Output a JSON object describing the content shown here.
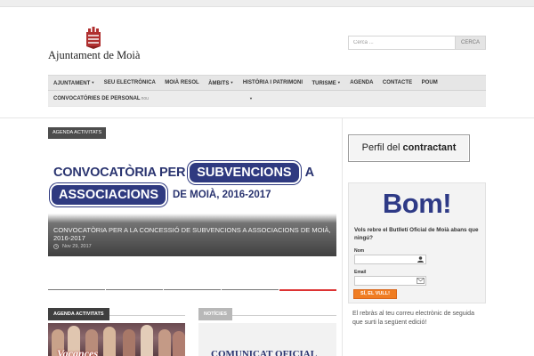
{
  "logo": {
    "text": "Ajuntament de Moià"
  },
  "search": {
    "placeholder": "Cerca ...",
    "button_label": "CERCA"
  },
  "nav": {
    "row1": [
      {
        "label": "Ajuntament",
        "dropdown": true
      },
      {
        "label": "Seu electrònica",
        "dropdown": false
      },
      {
        "label": "Moià resol",
        "dropdown": false
      },
      {
        "label": "Àmbits",
        "dropdown": true
      },
      {
        "label": "Història i patrimoni",
        "dropdown": false
      },
      {
        "label": "Turisme",
        "dropdown": true
      },
      {
        "label": "Agenda",
        "dropdown": false
      },
      {
        "label": "Contacte",
        "dropdown": false
      },
      {
        "label": "POUM",
        "dropdown": false
      }
    ],
    "row2_select": {
      "label": "Convocatòries de personal",
      "suffix": "nou"
    }
  },
  "slider": {
    "tag": "Agenda activitats",
    "image_text": {
      "part1": "CONVOCATÒRIA PER",
      "pill1": "SUBVENCIONS",
      "part2": "A",
      "pill2": "ASSOCIACIONS",
      "part3": "DE MOIÀ, 2016-2017"
    },
    "caption": "Convocatòria per a la concessió de subvencions a associacions de Moià, 2016-2017",
    "date": "Nov 29, 2017",
    "tab_count": 5,
    "active_tab": 5
  },
  "sections": {
    "left": {
      "label": "Agenda activitats",
      "thumb_text": "Vacances"
    },
    "right": {
      "label": "Notícies",
      "thumb_text": "COMUNICAT OFICIAL"
    }
  },
  "sidebar": {
    "perfil": {
      "light": "Perfil del",
      "bold": "contractant"
    },
    "newsletter": {
      "headline": "Bom!",
      "text": "Vols rebre el Butlletí Oficial de Moià abans que ningú?",
      "name_label": "Nom",
      "email_label": "Email",
      "button": "Sí, el vull!",
      "footer": "El rebràs al teu correu electrònic de seguida que surti la següent edició!"
    }
  },
  "colors": {
    "brand_blue": "#2e3a86",
    "accent_red": "#d33333",
    "button_orange": "#f07d22"
  }
}
